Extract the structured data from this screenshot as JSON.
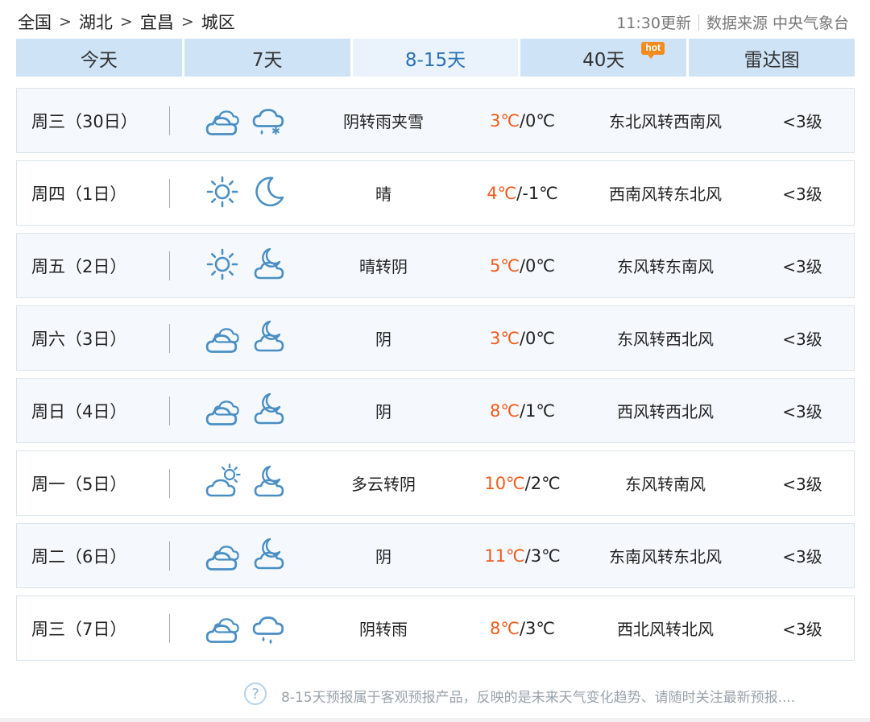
{
  "breadcrumb": [
    "全国",
    "湖北",
    "宜昌",
    "城区"
  ],
  "update_time": "11:30更新",
  "data_source": "数据来源 中央气象台",
  "tabs": [
    {
      "label": "今天",
      "active": false
    },
    {
      "label": "7天",
      "active": false
    },
    {
      "label": "8-15天",
      "active": true
    },
    {
      "label": "40天",
      "active": false,
      "badge": "hot"
    },
    {
      "label": "雷达图",
      "active": false
    }
  ],
  "days": [
    {
      "day": "周三（30日）",
      "icons": [
        "cloudy-icon",
        "snow-icon"
      ],
      "desc": "阴转雨夹雪",
      "high": "3℃",
      "low": "/0℃",
      "wind": "东北风转西南风",
      "level": "<3级"
    },
    {
      "day": "周四（1日）",
      "icons": [
        "sun-icon",
        "moon-icon"
      ],
      "desc": "晴",
      "high": "4℃",
      "low": "/-1℃",
      "wind": "西南风转东北风",
      "level": "<3级"
    },
    {
      "day": "周五（2日）",
      "icons": [
        "sun-icon",
        "cloud-night-icon"
      ],
      "desc": "晴转阴",
      "high": "5℃",
      "low": "/0℃",
      "wind": "东风转东南风",
      "level": "<3级"
    },
    {
      "day": "周六（3日）",
      "icons": [
        "cloudy-icon",
        "cloud-night-icon"
      ],
      "desc": "阴",
      "high": "3℃",
      "low": "/0℃",
      "wind": "东风转西北风",
      "level": "<3级"
    },
    {
      "day": "周日（4日）",
      "icons": [
        "cloudy-icon",
        "cloud-night-icon"
      ],
      "desc": "阴",
      "high": "8℃",
      "low": "/1℃",
      "wind": "西风转西北风",
      "level": "<3级"
    },
    {
      "day": "周一（5日）",
      "icons": [
        "partly-cloudy-icon",
        "cloud-night-icon"
      ],
      "desc": "多云转阴",
      "high": "10℃",
      "low": "/2℃",
      "wind": "东风转南风",
      "level": "<3级"
    },
    {
      "day": "周二（6日）",
      "icons": [
        "cloudy-icon",
        "cloud-night-icon"
      ],
      "desc": "阴",
      "high": "11℃",
      "low": "/3℃",
      "wind": "东南风转东北风",
      "level": "<3级"
    },
    {
      "day": "周三（7日）",
      "icons": [
        "cloudy-icon",
        "rain-icon"
      ],
      "desc": "阴转雨",
      "high": "8℃",
      "low": "/3℃",
      "wind": "西北风转北风",
      "level": "<3级"
    }
  ],
  "footer_note": "8-15天预报属于客观预报产品，反映的是未来天气变化趋势、请随时关注最新预报....",
  "colors": {
    "accent": "#2a6fb8",
    "tab_bg": "#cfe3f7",
    "high_temp": "#f05a1a",
    "icon": "#4a8fc4"
  }
}
